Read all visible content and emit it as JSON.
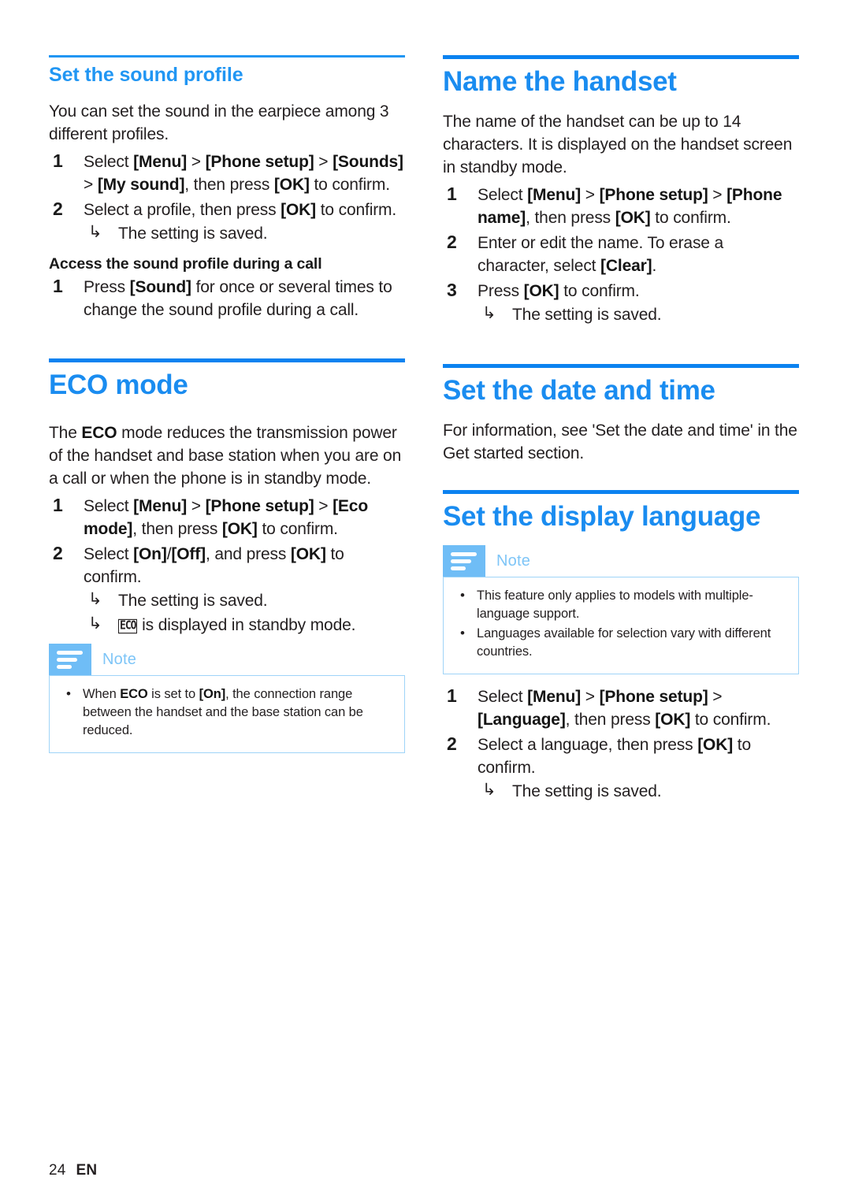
{
  "page": {
    "footer_page_number": "24",
    "footer_language": "EN"
  },
  "colors": {
    "heading_blue": "#1a8cf0",
    "subheading_blue": "#2196f3",
    "note_tab_blue": "#6fbdf6",
    "note_title_blue": "#7ec5f7",
    "note_border_blue": "#9fd4f8",
    "body_text": "#231f20"
  },
  "left_column": {
    "sound_profile": {
      "heading": "Set the sound profile",
      "intro": "You can set the sound in the earpiece among 3 different profiles.",
      "steps": [
        {
          "num": "1",
          "parts": [
            {
              "t": "Select ",
              "b": false
            },
            {
              "t": "[Menu]",
              "b": true
            },
            {
              "t": " > ",
              "b": false
            },
            {
              "t": "[Phone setup]",
              "b": true
            },
            {
              "t": " > ",
              "b": false
            },
            {
              "t": "[Sounds]",
              "b": true
            },
            {
              "t": " > ",
              "b": false
            },
            {
              "t": "[My sound]",
              "b": true
            },
            {
              "t": ", then press ",
              "b": false
            },
            {
              "t": "[OK]",
              "b": true
            },
            {
              "t": " to confirm.",
              "b": false
            }
          ],
          "result": null
        },
        {
          "num": "2",
          "parts": [
            {
              "t": "Select a profile, then press ",
              "b": false
            },
            {
              "t": "[OK]",
              "b": true
            },
            {
              "t": " to confirm.",
              "b": false
            }
          ],
          "result": "The setting is saved."
        }
      ],
      "subheading": "Access the sound profile during a call",
      "sub_steps": [
        {
          "num": "1",
          "parts": [
            {
              "t": "Press ",
              "b": false
            },
            {
              "t": "[Sound]",
              "b": true
            },
            {
              "t": " for once or several times to change the sound profile during a call.",
              "b": false
            }
          ],
          "result": null
        }
      ]
    },
    "eco_mode": {
      "heading": "ECO mode",
      "intro_parts": [
        {
          "t": "The ",
          "b": false
        },
        {
          "t": "ECO",
          "b": true
        },
        {
          "t": " mode reduces the transmission power of the handset and base station when you are on a call or when the phone is in standby mode.",
          "b": false
        }
      ],
      "steps": [
        {
          "num": "1",
          "parts": [
            {
              "t": "Select ",
              "b": false
            },
            {
              "t": "[Menu]",
              "b": true
            },
            {
              "t": " > ",
              "b": false
            },
            {
              "t": "[Phone setup]",
              "b": true
            },
            {
              "t": " > ",
              "b": false
            },
            {
              "t": "[Eco mode]",
              "b": true
            },
            {
              "t": ", then press ",
              "b": false
            },
            {
              "t": "[OK]",
              "b": true
            },
            {
              "t": " to confirm.",
              "b": false
            }
          ],
          "result": null
        },
        {
          "num": "2",
          "parts": [
            {
              "t": "Select ",
              "b": false
            },
            {
              "t": "[On]",
              "b": true
            },
            {
              "t": "/",
              "b": false
            },
            {
              "t": "[Off]",
              "b": true
            },
            {
              "t": ", and press ",
              "b": false
            },
            {
              "t": "[OK]",
              "b": true
            },
            {
              "t": " to confirm.",
              "b": false
            }
          ],
          "result": "The setting is saved.",
          "result2_prefix_icon": "ECO",
          "result2": "is displayed in standby mode."
        }
      ],
      "note": {
        "title": "Note",
        "items": [
          [
            {
              "t": "When ",
              "b": false
            },
            {
              "t": "ECO",
              "b": true
            },
            {
              "t": " is set to ",
              "b": false
            },
            {
              "t": "[On]",
              "b": true
            },
            {
              "t": ", the connection range between the handset and the base station can be reduced.",
              "b": false
            }
          ]
        ]
      }
    }
  },
  "right_column": {
    "name_handset": {
      "heading": "Name the handset",
      "intro": "The name of the handset can be up to 14 characters. It is displayed on the handset screen in standby mode.",
      "steps": [
        {
          "num": "1",
          "parts": [
            {
              "t": "Select ",
              "b": false
            },
            {
              "t": "[Menu]",
              "b": true
            },
            {
              "t": " > ",
              "b": false
            },
            {
              "t": "[Phone setup]",
              "b": true
            },
            {
              "t": " > ",
              "b": false
            },
            {
              "t": "[Phone name]",
              "b": true
            },
            {
              "t": ", then press ",
              "b": false
            },
            {
              "t": "[OK]",
              "b": true
            },
            {
              "t": " to confirm.",
              "b": false
            }
          ],
          "result": null
        },
        {
          "num": "2",
          "parts": [
            {
              "t": "Enter or edit the name. To erase a character, select ",
              "b": false
            },
            {
              "t": "[Clear]",
              "b": true
            },
            {
              "t": ".",
              "b": false
            }
          ],
          "result": null
        },
        {
          "num": "3",
          "parts": [
            {
              "t": "Press ",
              "b": false
            },
            {
              "t": "[OK]",
              "b": true
            },
            {
              "t": " to confirm.",
              "b": false
            }
          ],
          "result": "The setting is saved."
        }
      ]
    },
    "date_time": {
      "heading": "Set the date and time",
      "intro": "For information, see 'Set the date and time' in the Get started section."
    },
    "display_language": {
      "heading": "Set the display language",
      "note": {
        "title": "Note",
        "items": [
          [
            {
              "t": "This feature only applies to models with multiple-language support.",
              "b": false
            }
          ],
          [
            {
              "t": "Languages available for selection vary with different countries.",
              "b": false
            }
          ]
        ]
      },
      "steps": [
        {
          "num": "1",
          "parts": [
            {
              "t": "Select ",
              "b": false
            },
            {
              "t": "[Menu]",
              "b": true
            },
            {
              "t": " > ",
              "b": false
            },
            {
              "t": "[Phone setup]",
              "b": true
            },
            {
              "t": " > ",
              "b": false
            },
            {
              "t": "[Language]",
              "b": true
            },
            {
              "t": ", then press ",
              "b": false
            },
            {
              "t": "[OK]",
              "b": true
            },
            {
              "t": " to confirm.",
              "b": false
            }
          ],
          "result": null
        },
        {
          "num": "2",
          "parts": [
            {
              "t": "Select a language, then press ",
              "b": false
            },
            {
              "t": "[OK]",
              "b": true
            },
            {
              "t": " to confirm.",
              "b": false
            }
          ],
          "result": "The setting is saved."
        }
      ]
    }
  }
}
